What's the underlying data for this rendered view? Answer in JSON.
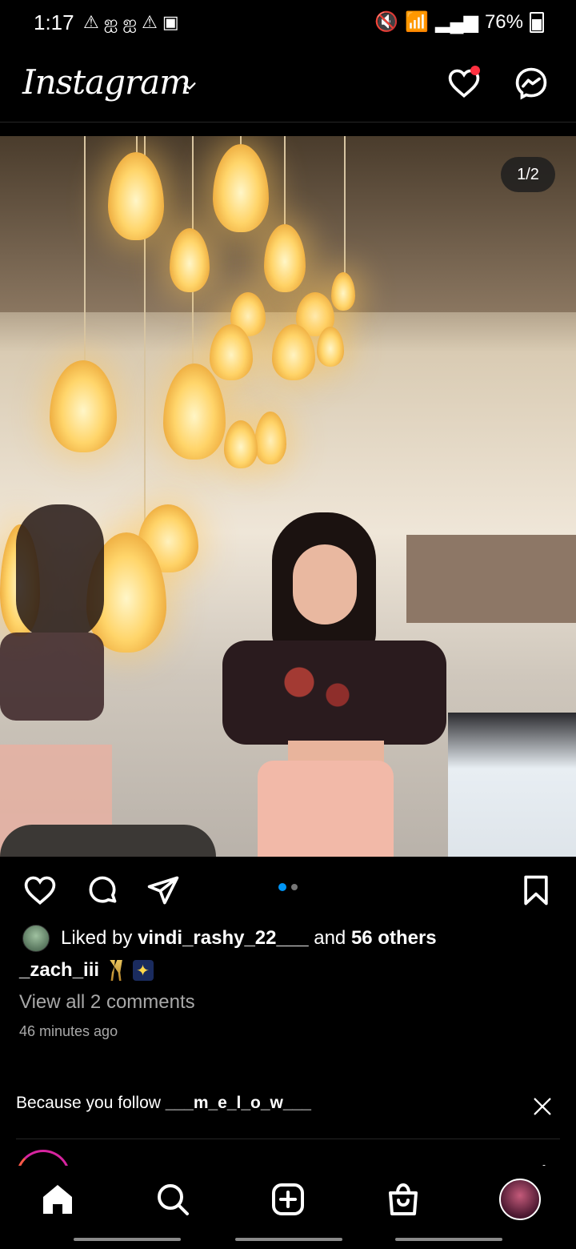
{
  "status_bar": {
    "time": "1:17",
    "battery": "76%",
    "notification_icons": [
      "alert-icon",
      "app-icon",
      "app-icon",
      "alert-icon",
      "image-icon"
    ]
  },
  "header": {
    "logo": "Instagram"
  },
  "post": {
    "carousel_counter": "1/2",
    "carousel_dots": 2,
    "carousel_active": 0,
    "liked_by_prefix": "Liked by ",
    "liked_by_user": "vindi_rashy_22___",
    "liked_by_middle": " and ",
    "liked_by_others": "56 others",
    "caption_user": "_zach_iii",
    "view_comments": "View all 2 comments",
    "time_ago": "46 minutes ago"
  },
  "suggestion": {
    "prefix": "Because you follow ",
    "account": "___m_e_l_o_w___"
  },
  "colors": {
    "like_dot": "#ff3040",
    "carousel_active_dot": "#0095f6"
  }
}
